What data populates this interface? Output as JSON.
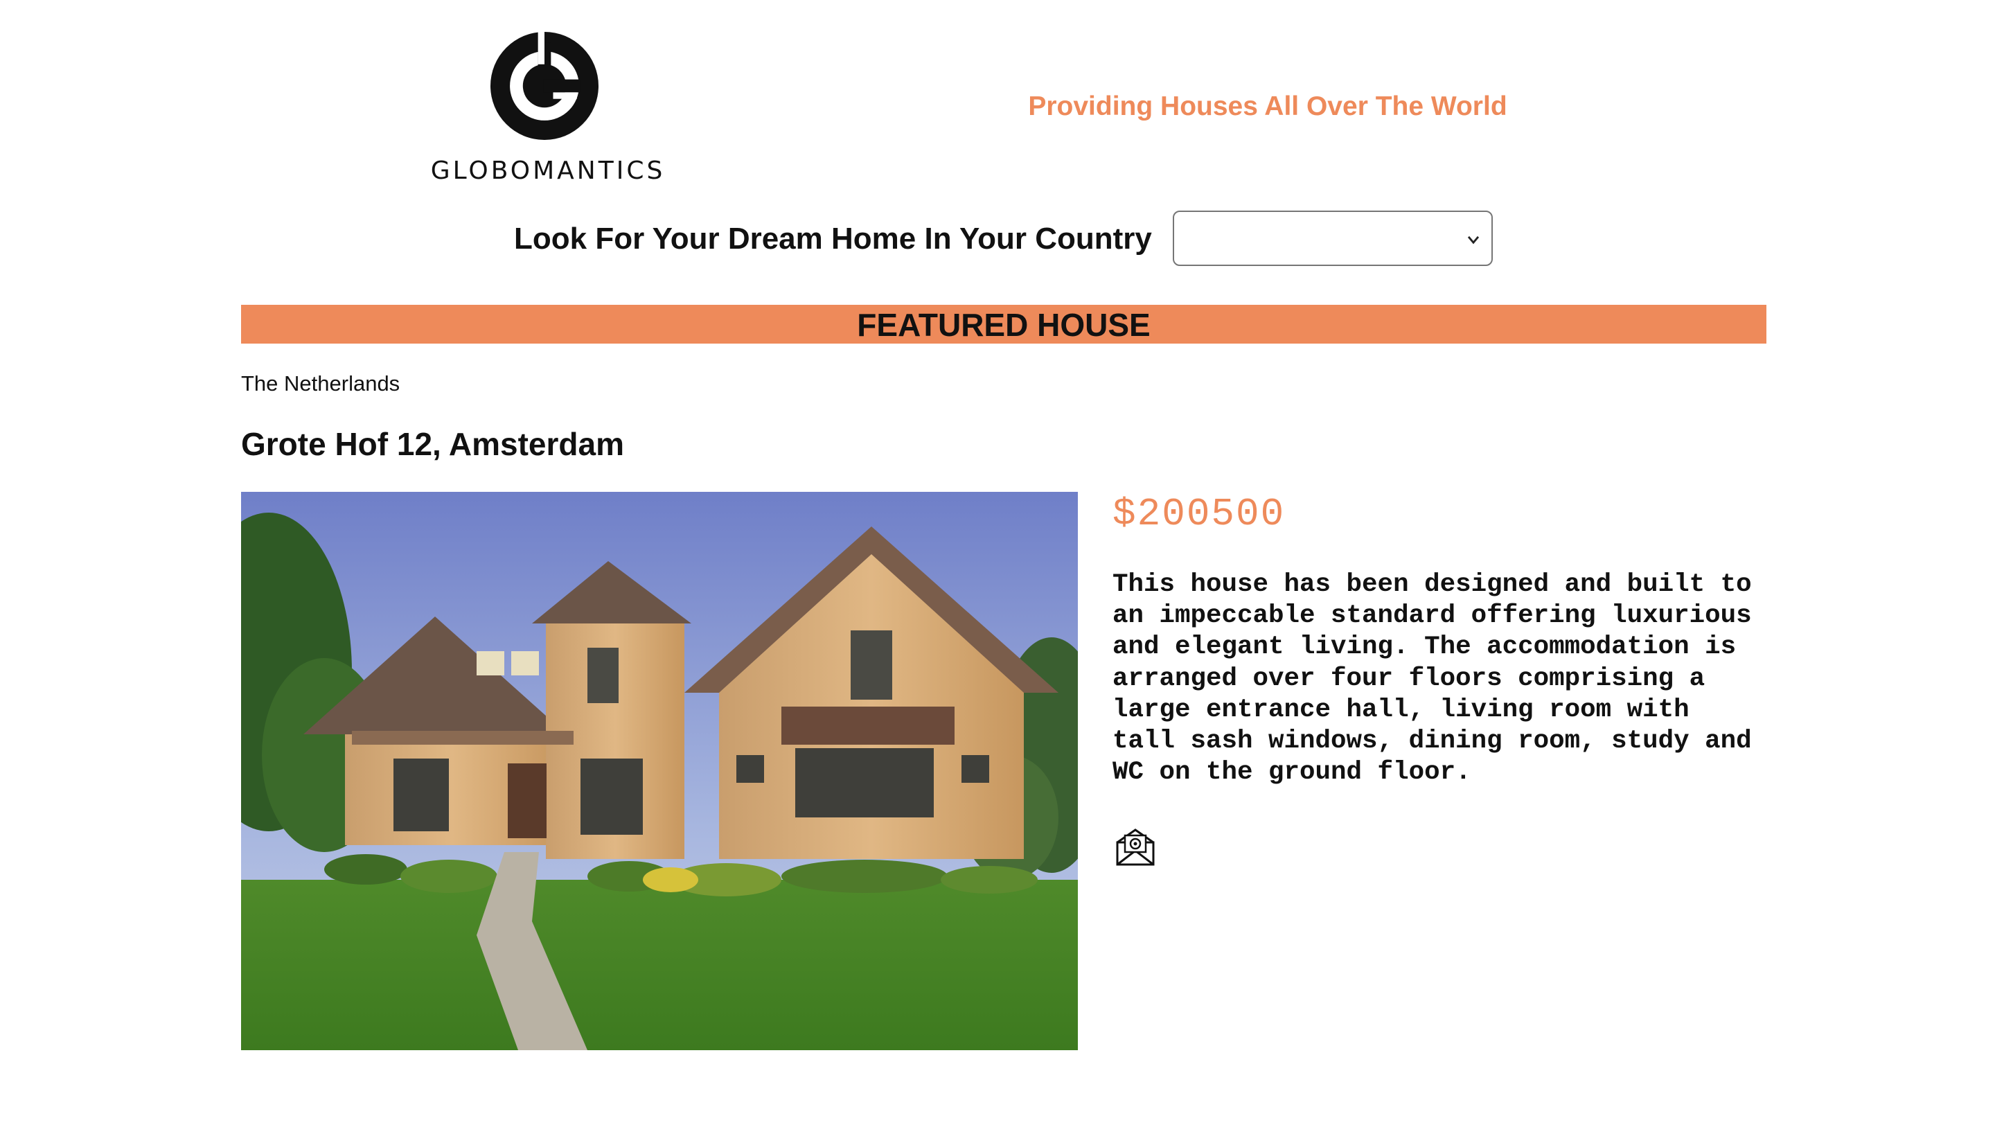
{
  "header": {
    "logo_text": "GLOBOMANTICS",
    "logo_icon": "globomantics-logo-icon",
    "tagline": "Providing Houses All Over The World"
  },
  "search": {
    "label": "Look For Your Dream Home In Your Country",
    "selected_value": "",
    "dropdown_icon": "chevron-down-icon"
  },
  "featured": {
    "banner_title": "FEATURED HOUSE",
    "country": "The Netherlands",
    "address": "Grote Hof 12, Amsterdam",
    "price": "$200500",
    "description": "This house has been designed and built to an impeccable standard offering luxurious and elegant living. The accommodation is arranged over four floors comprising a large entrance hall, living room with tall sash windows, dining room, study and WC on the ground floor.",
    "contact_icon": "email-icon"
  },
  "colors": {
    "accent": "#ee8a5a",
    "text": "#111111",
    "background": "#ffffff"
  }
}
